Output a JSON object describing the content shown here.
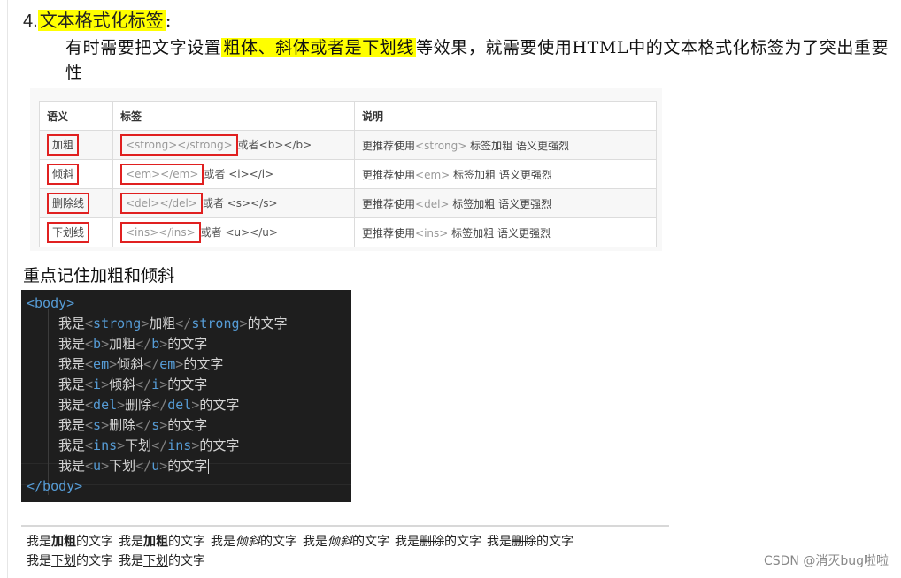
{
  "heading": {
    "number": "4.",
    "title": "文本格式化标签",
    "colon": ":"
  },
  "paragraph": {
    "before": "有时需要把文字设置",
    "highlight": "粗体、斜体或者是下划线",
    "after": "等效果，就需要使用HTML中的文本格式化标签为了突出重要性"
  },
  "table": {
    "headers": [
      "语义",
      "标签",
      "说明"
    ],
    "rows": [
      {
        "meaning": "加粗",
        "tag": "<strong></strong>",
        "alt": "或者<b></b>",
        "note_a": "更推荐使用",
        "note_tag": "<strong>",
        "note_b": " 标签加粗 语义更强烈"
      },
      {
        "meaning": "倾斜",
        "tag": "<em></em>",
        "alt": "或者 <i></i>",
        "note_a": "更推荐使用",
        "note_tag": "<em>",
        "note_b": " 标签加粗 语义更强烈"
      },
      {
        "meaning": "删除线",
        "tag": "<del></del>",
        "alt": "或者 <s></s>",
        "note_a": "更推荐使用",
        "note_tag": "<del>",
        "note_b": " 标签加粗 语义更强烈"
      },
      {
        "meaning": "下划线",
        "tag": "<ins></ins>",
        "alt": "或者 <u></u>",
        "note_a": "更推荐使用",
        "note_tag": "<ins>",
        "note_b": " 标签加粗 语义更强烈"
      }
    ]
  },
  "subheading": "重点记住加粗和倾斜",
  "code": {
    "open": "<body>",
    "close": "</body>",
    "lines": [
      {
        "pre": "我是",
        "tag": "strong",
        "word": "加粗",
        "post": "的文字"
      },
      {
        "pre": "我是",
        "tag": "b",
        "word": "加粗",
        "post": "的文字"
      },
      {
        "pre": "我是",
        "tag": "em",
        "word": "倾斜",
        "post": "的文字"
      },
      {
        "pre": "我是",
        "tag": "i",
        "word": "倾斜",
        "post": "的文字"
      },
      {
        "pre": "我是",
        "tag": "del",
        "word": "删除",
        "post": "的文字"
      },
      {
        "pre": "我是",
        "tag": "s",
        "word": "删除",
        "post": "的文字"
      },
      {
        "pre": "我是",
        "tag": "ins",
        "word": "下划",
        "post": "的文字"
      },
      {
        "pre": "我是",
        "tag": "u",
        "word": "下划",
        "post": "的文字"
      }
    ]
  },
  "output": {
    "items": [
      {
        "pre": "我是",
        "word": "加粗",
        "post": "的文字",
        "style": "bold"
      },
      {
        "pre": "我是",
        "word": "加粗",
        "post": "的文字",
        "style": "bold"
      },
      {
        "pre": "我是",
        "word": "倾斜",
        "post": "的文字",
        "style": "italic"
      },
      {
        "pre": "我是",
        "word": "倾斜",
        "post": "的文字",
        "style": "italic"
      },
      {
        "pre": "我是",
        "word": "删除",
        "post": "的文字",
        "style": "strike"
      },
      {
        "pre": "我是",
        "word": "删除",
        "post": "的文字",
        "style": "strike"
      },
      {
        "pre": "我是",
        "word": "下划",
        "post": "的文字",
        "style": "underline"
      },
      {
        "pre": "我是",
        "word": "下划",
        "post": "的文字",
        "style": "underline"
      }
    ]
  },
  "watermark": "CSDN @消灭bug啦啦",
  "colors": {
    "highlight": "#ffff00",
    "mark_border": "#e02020",
    "code_bg": "#1e1e1e",
    "code_tag": "#569cd6"
  }
}
